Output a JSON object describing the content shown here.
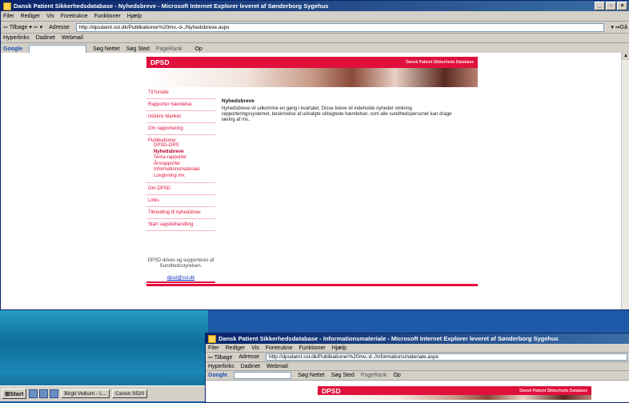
{
  "window1": {
    "title": "Dansk Patient Sikkerhedsdatabase - Nyhedsbreve - Microsoft Internet Explorer leveret af Sønderborg Sygehus",
    "menu": [
      "Filer",
      "Rediger",
      "Vis",
      "Foretrukne",
      "Funktioner",
      "Hjælp"
    ],
    "toolbar": {
      "back": "Tilbage",
      "address_label": "Adresse",
      "address": "http://dpsdamt.sst.dk/Publikationer%20mv,-d-,/Nyhedsbreve.aspx",
      "go": "Gå"
    },
    "links": {
      "label": "Hyperlinks",
      "items": [
        "Dadinet",
        "Webmail"
      ]
    },
    "google": {
      "logo": "Google",
      "search_web": "Søg Nettet",
      "search_site": "Søg Sted",
      "pagerank": "PageRank",
      "blocked": "",
      "options": "Op"
    },
    "site": {
      "logo": "DPSD",
      "subtitle": "Dansk Patient Sikkerheds Database",
      "nav": [
        "Til forside",
        "Rapportér hændelse",
        "Udskriv blanket",
        "Om rapportering"
      ],
      "nav_group": {
        "head": "Publikationer",
        "items": [
          "DPSD-ORS",
          "Nyhedsbreve",
          "Tema-rapporter",
          "Årsrapporter",
          "Informationsmateriale",
          "Lovgivning mv."
        ],
        "active": "Nyhedsbreve"
      },
      "nav2": [
        "Om DPSD",
        "Links",
        "Tilmelding til nyhedsbrev",
        "Start sagsbehandling"
      ],
      "footer_text": "DPSD drives og supporteres af Sundhedsstyrelsen.",
      "footer_mail": "dpsd@sst.dk",
      "heading": "Nyhedsbreve",
      "body": "Nyhedsbreve vil udkomme en gang i kvartalet. Disse breve vil indeholde nyheder omkring rapporteringssystemet, beskrivelse af udvalgte utilsigtede hændelser, som alle sundhedspersoner kan drage læring af mv.."
    }
  },
  "window2": {
    "title": "Dansk Patient Sikkerhedsdatabase - Informationsmateriale - Microsoft Internet Explorer leveret af Sønderborg Sygehus",
    "menu": [
      "Filer",
      "Rediger",
      "Vis",
      "Foretrukne",
      "Funktioner",
      "Hjælp"
    ],
    "toolbar": {
      "back": "Tilbage",
      "address_label": "Adresse",
      "address": "http://dpsdamt.sst.dk/Publikationer%20mv,-d-,/Informationsmateriale.aspx"
    },
    "links": {
      "label": "Hyperlinks",
      "items": [
        "Dadinet",
        "Webmail"
      ]
    },
    "google": {
      "logo": "Google",
      "search_web": "Søg Nettet",
      "search_site": "Søg Sted",
      "pagerank": "PageRank",
      "options": "Op"
    },
    "site": {
      "logo": "DPSD",
      "subtitle": "Dansk Patient Sikkerheds Database"
    }
  },
  "taskbar": {
    "start": "Start",
    "tasks": [
      "Birgit Velkum - L...",
      "Canon S520"
    ]
  }
}
